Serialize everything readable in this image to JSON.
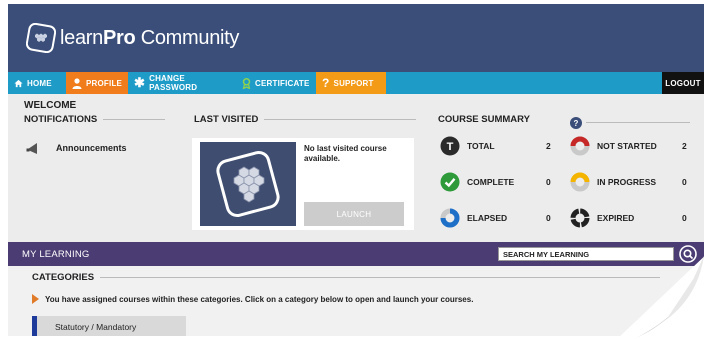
{
  "header": {
    "logo_prefix": "learn",
    "logo_bold": "Pro",
    "logo_suffix": " Community"
  },
  "nav": {
    "home": "HOME",
    "profile": "PROFILE",
    "change_password": "CHANGE PASSWORD",
    "certificate": "CERTIFICATE",
    "support": "SUPPORT",
    "logout": "LOGOUT"
  },
  "welcome": "WELCOME",
  "notifications": {
    "title": "NOTIFICATIONS",
    "items": [
      {
        "label": "Announcements",
        "icon": "megaphone-icon"
      }
    ]
  },
  "last_visited": {
    "title": "LAST VISITED",
    "message": "No last visited course available.",
    "launch_label": "LAUNCH"
  },
  "course_summary": {
    "title": "COURSE SUMMARY",
    "help_icon": "?",
    "items": [
      {
        "label": "TOTAL",
        "count": "2",
        "icon": "total-icon",
        "icon_letter": "T",
        "color": "#2b2b2b"
      },
      {
        "label": "NOT STARTED",
        "count": "2",
        "icon": "not-started-icon",
        "color": "#c62828"
      },
      {
        "label": "COMPLETE",
        "count": "0",
        "icon": "complete-icon",
        "color": "#2e9a3a"
      },
      {
        "label": "IN PROGRESS",
        "count": "0",
        "icon": "in-progress-icon",
        "color": "#f4b400"
      },
      {
        "label": "ELAPSED",
        "count": "0",
        "icon": "elapsed-icon",
        "color": "#1e6fc8"
      },
      {
        "label": "EXPIRED",
        "count": "0",
        "icon": "expired-icon",
        "color": "#222222"
      }
    ]
  },
  "my_learning": {
    "title": "MY LEARNING",
    "search_label": "SEARCH MY LEARNING"
  },
  "categories": {
    "title": "CATEGORIES",
    "message": "You have assigned courses within these categories. Click on a category below to open and launch your courses.",
    "items": [
      "Statutory / Mandatory"
    ]
  },
  "colors": {
    "header": "#3a4e79",
    "nav": "#1f9bc8",
    "profile": "#f07c1b",
    "support": "#f39a17",
    "my_learning_bar": "#4b3d73",
    "category_accent": "#1e3a9a"
  }
}
